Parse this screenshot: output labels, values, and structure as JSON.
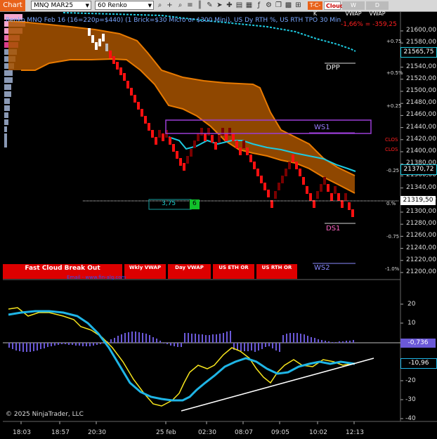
{
  "toolbar": {
    "chart_tab": "Chart",
    "instrument": "MNQ MAR25",
    "period": "60 Renko",
    "buttons": [
      "T-C-K",
      "Cloud",
      "W VWAP",
      "D VWAP"
    ]
  },
  "header": {
    "title": "Renko MNQ Feb 16 (16=220p=$440) (1 Brick=$30 Micro or $300 Mini), US Dy RTH %, US RTH TPO 30 Min",
    "change_pct": "-1,66%",
    "change_val": "= -359,25"
  },
  "price_axis": {
    "labels": [
      "21600,00",
      "21580,00",
      "21560,00",
      "21540,00",
      "21520,00",
      "21500,00",
      "21480,00",
      "21460,00",
      "21440,00",
      "21420,00",
      "21400,00",
      "21380,00",
      "21360,00",
      "21340,00",
      "21320,00",
      "21300,00",
      "21280,00",
      "21260,00",
      "21240,00",
      "21220,00",
      "21200,00"
    ],
    "tag_top": "21565,75",
    "tag_mid": "21370,72",
    "tag_price": "21319,50"
  },
  "pct_labels": {
    "p075": "+0.75",
    "p05": "+0.5%",
    "p025": "+0.25",
    "p0": "0.%",
    "m025": "-0.25",
    "m075": "-0.75",
    "m1": "-1.0%"
  },
  "levels": {
    "dpp": "DPP",
    "ws1": "WS1",
    "ds1": "DS1",
    "ws2": "WS2",
    "clos1": "CLOS",
    "clos2": "CLOS"
  },
  "box": {
    "left": "3,75",
    "right": "6"
  },
  "buttons": {
    "b1": "Fast Cloud Break Out",
    "b2": "Wkly VWAP",
    "b3": "Day VWAP",
    "b4": "US ETH OR",
    "b5": "US RTH OR"
  },
  "watermark": "Email - www.fin-alg.com",
  "osc_axis": {
    "labels": [
      "20",
      "10",
      "-20",
      "-30",
      "-40"
    ],
    "tag1": "-0,736",
    "tag2": "-10,96"
  },
  "copyright": "© 2025 NinjaTrader, LLC",
  "x_axis": [
    "18:03",
    "18:57",
    "20:30",
    "25 feb",
    "02:30",
    "08:07",
    "09:05",
    "10:02",
    "12:13"
  ],
  "colors": {
    "up": "#ff1010",
    "cloud": "#b35b00",
    "cyan": "#1ecbe1",
    "yellow": "#f7e51d",
    "purple": "#8a4dff"
  }
}
